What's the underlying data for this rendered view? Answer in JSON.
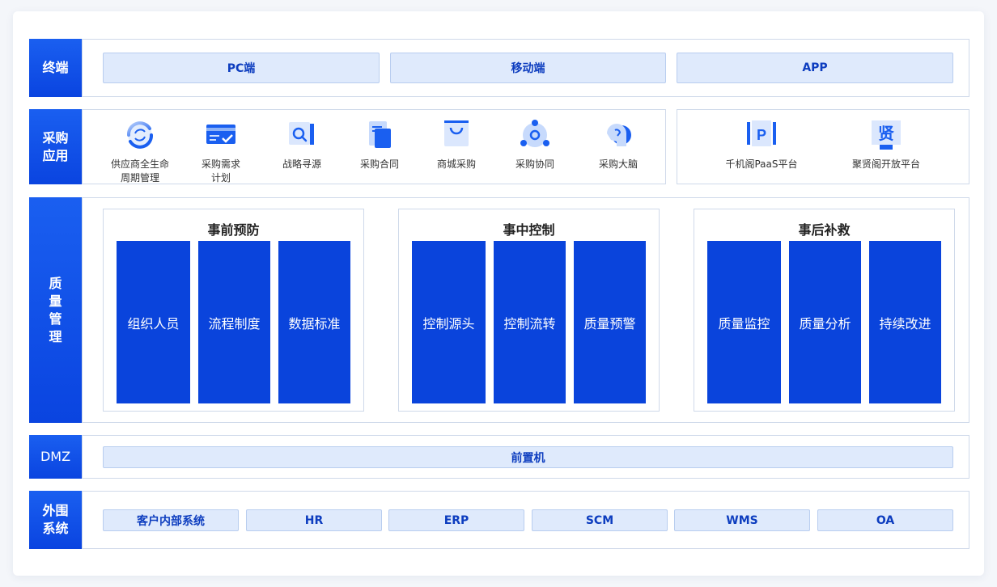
{
  "rows": {
    "terminal": {
      "label": "终端",
      "items": [
        "PC端",
        "移动端",
        "APP"
      ]
    },
    "apps": {
      "label": "采购\n应用",
      "items": [
        {
          "label": "供应商全生命\n周期管理",
          "icon": "cycle-icon"
        },
        {
          "label": "采购需求\n计划",
          "icon": "demand-card-icon"
        },
        {
          "label": "战略寻源",
          "icon": "magnify-icon"
        },
        {
          "label": "采购合同",
          "icon": "document-icon"
        },
        {
          "label": "商城采购",
          "icon": "shopping-bag-icon"
        },
        {
          "label": "采购协同",
          "icon": "collaboration-icon"
        },
        {
          "label": "采购大脑",
          "icon": "brain-head-icon"
        }
      ],
      "platforms": [
        {
          "label": "千机阁PaaS平台",
          "icon": "paas-p-icon",
          "glyph": "P"
        },
        {
          "label": "聚贤阁开放平台",
          "icon": "open-platform-icon",
          "glyph": "贤"
        }
      ]
    },
    "quality": {
      "label": "质量管理",
      "groups": [
        {
          "title": "事前预防",
          "items": [
            "组织人员",
            "流程制度",
            "数据标准"
          ]
        },
        {
          "title": "事中控制",
          "items": [
            "控制源头",
            "控制流转",
            "质量预警"
          ]
        },
        {
          "title": "事后补救",
          "items": [
            "质量监控",
            "质量分析",
            "持续改进"
          ]
        }
      ]
    },
    "dmz": {
      "label": "DMZ",
      "item": "前置机"
    },
    "external": {
      "label": "外围\n系统",
      "items": [
        "客户内部系统",
        "HR",
        "ERP",
        "SCM",
        "WMS",
        "OA"
      ]
    }
  },
  "colors": {
    "primary": "#0a44dc",
    "chip_bg": "#dfeafc",
    "chip_text": "#0d3dbf",
    "border": "#cfd9ea"
  }
}
